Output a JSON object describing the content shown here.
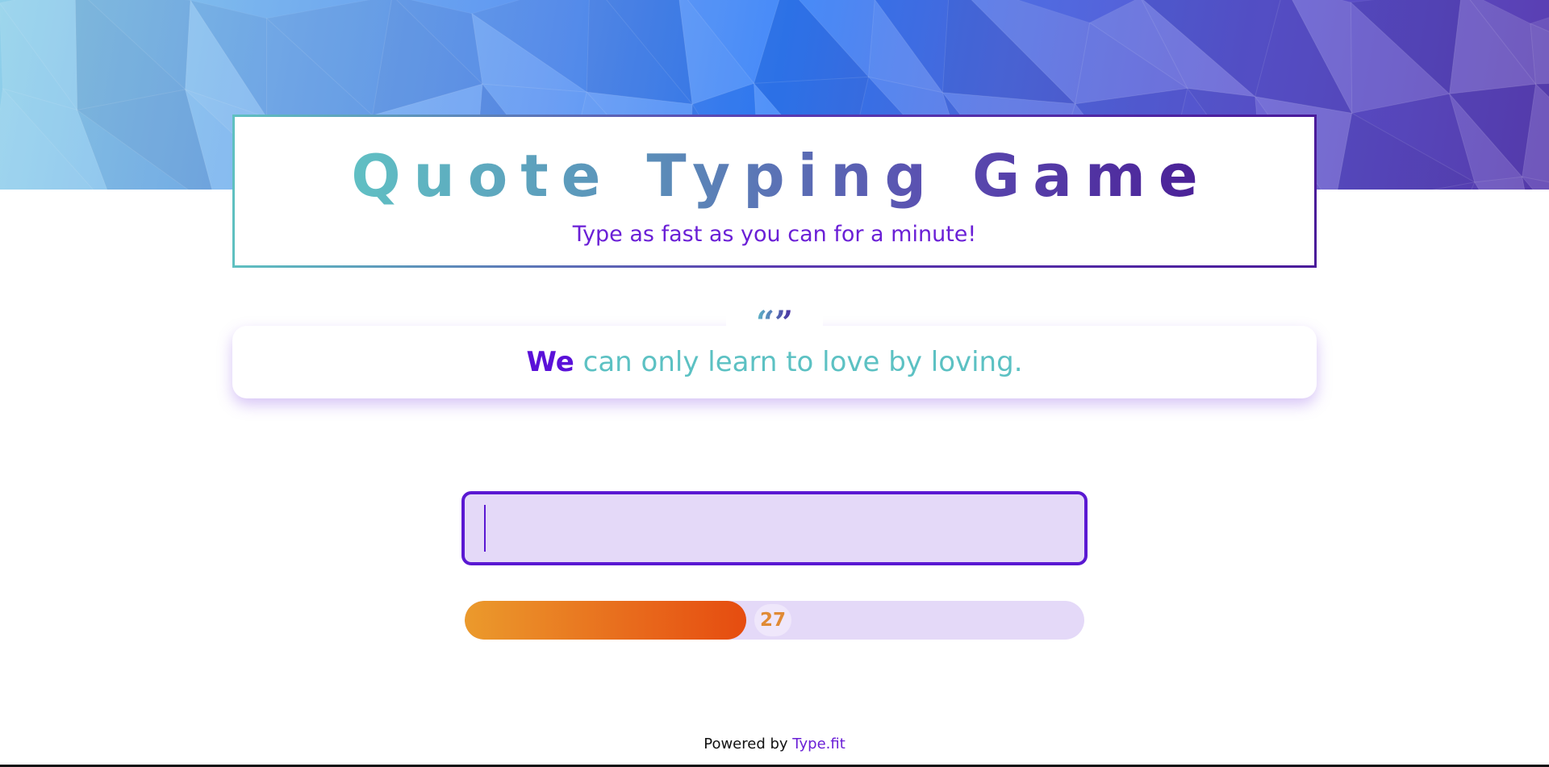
{
  "header": {
    "title": "Quote Typing Game",
    "subtitle": "Type as fast as you can for a minute!",
    "gradient_colors": [
      "#60c2c4",
      "#5b8ab8",
      "#5a4bb0",
      "#4a1f96"
    ]
  },
  "quote": {
    "mark": "“”",
    "typed_word": "We",
    "remaining_text": " can only learn to love by loving.",
    "typed_color": "#5a10d8",
    "remaining_color": "#5cc1c3"
  },
  "input": {
    "value": "",
    "placeholder": "",
    "border_color": "#5a18d2",
    "background": "#e4d9f8"
  },
  "progress": {
    "count": "27",
    "fraction": 0.455,
    "fill_colors": [
      "#eb9a2c",
      "#e64c10"
    ]
  },
  "footer": {
    "prefix": "Powered by ",
    "link_label": "Type.fit"
  },
  "banner": {
    "colors": [
      "#8fd0ea",
      "#5d95f2",
      "#2f7cf7",
      "#5b55d0",
      "#5a3db0"
    ]
  }
}
